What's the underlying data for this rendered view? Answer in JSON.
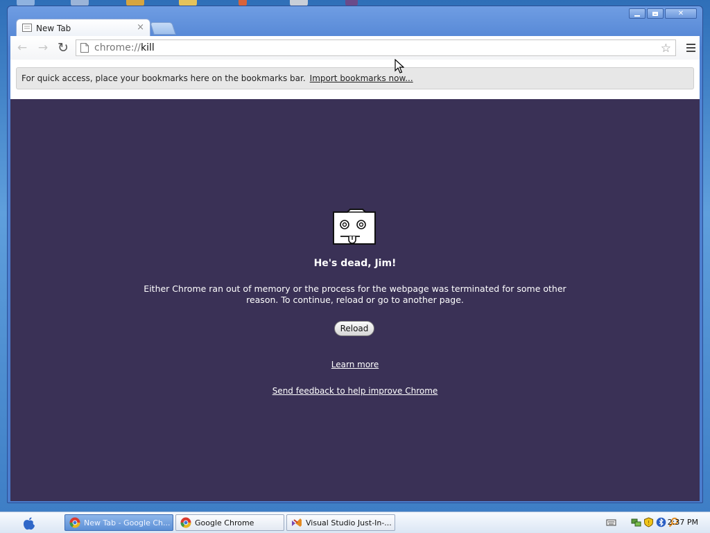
{
  "window": {
    "controls": {
      "minimize": "",
      "maximize": "",
      "close": "✕"
    }
  },
  "tab": {
    "title": "New Tab",
    "close": "×",
    "page_icon": "page-icon"
  },
  "toolbar": {
    "back": "←",
    "forward": "→",
    "reload": "↻",
    "omnibox": {
      "scheme": "chrome://",
      "host": "kill"
    },
    "star": "☆",
    "menu_icon": "hamburger-icon"
  },
  "bookmarks_bar": {
    "message": "For quick access, place your bookmarks here on the bookmarks bar.",
    "link": "Import bookmarks now..."
  },
  "crash_page": {
    "icon": "sad-tab-icon",
    "title": "He's dead, Jim!",
    "message": "Either Chrome ran out of memory or the process for the webpage was terminated for some other reason.  To continue, reload or go to another page.",
    "reload_label": "Reload",
    "learn_more": "Learn more",
    "feedback": "Send feedback to help improve Chrome",
    "background": "#3a3156"
  },
  "taskbar": {
    "start_icon": "apple-icon",
    "buttons": [
      {
        "label": "New Tab - Google Ch...",
        "icon": "chrome-icon",
        "active": true
      },
      {
        "label": "Google Chrome",
        "icon": "chrome-icon",
        "active": false
      },
      {
        "label": "Visual Studio Just-In-...",
        "icon": "visual-studio-icon",
        "active": false
      }
    ],
    "tray_icons": [
      "keyboard-icon",
      "network-icon",
      "shield-icon",
      "bluetooth-icon",
      "search-icon"
    ],
    "clock": "2:37 PM"
  }
}
